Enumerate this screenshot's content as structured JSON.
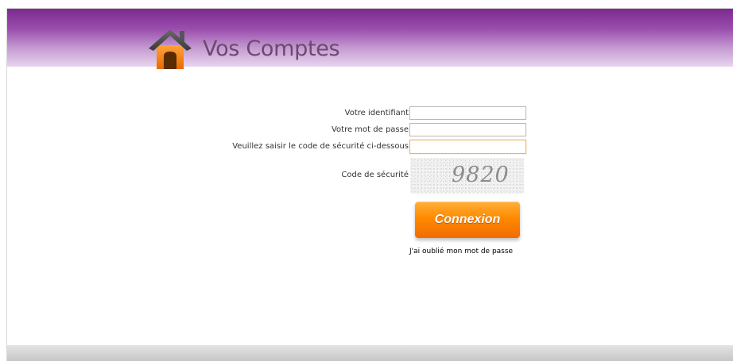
{
  "header": {
    "title": "Vos Comptes",
    "logo_icon": "house-icon",
    "colors": {
      "header_top": "#7b2a8e",
      "header_bottom": "#e7d5ee"
    }
  },
  "login_form": {
    "identifiant_label": "Votre identifiant",
    "identifiant_value": "",
    "password_label": "Votre mot de passe",
    "password_value": "",
    "security_input_label": "Veuillez saisir le code de sécurité ci-dessous",
    "security_input_value": "",
    "captcha_label": "Code de sécurité",
    "captcha_code": "9820",
    "submit_label": "Connexion",
    "submit_color": "#ff8a00",
    "forgot_password_label": "J'ai oublié mon mot de passe"
  }
}
